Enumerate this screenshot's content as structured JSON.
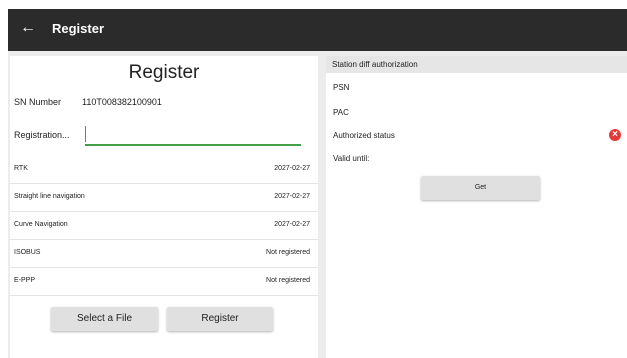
{
  "topbar": {
    "back_icon": "←",
    "title": "Register"
  },
  "left": {
    "title": "Register",
    "sn_label": "SN Number",
    "sn_value": "110T008382100901",
    "registration_label": "Registration...",
    "registration_value": "",
    "features": [
      {
        "name": "RTK",
        "value": "2027-02-27"
      },
      {
        "name": "Straight line navigation",
        "value": "2027-02-27"
      },
      {
        "name": "Curve Navigation",
        "value": "2027-02-27"
      },
      {
        "name": "ISOBUS",
        "value": "Not registered"
      },
      {
        "name": "E-PPP",
        "value": "Not registered"
      }
    ],
    "select_file_label": "Select a File",
    "register_label": "Register"
  },
  "right": {
    "header": "Station diff authorization",
    "psn_label": "PSN",
    "pac_label": "PAC",
    "auth_status_label": "Authorized status",
    "auth_status_icon": "×",
    "valid_until_label": "Valid until:",
    "get_label": "Get"
  },
  "colors": {
    "topbar": "#2b2b2b",
    "input_accent": "#43a047",
    "error": "#e53935"
  }
}
